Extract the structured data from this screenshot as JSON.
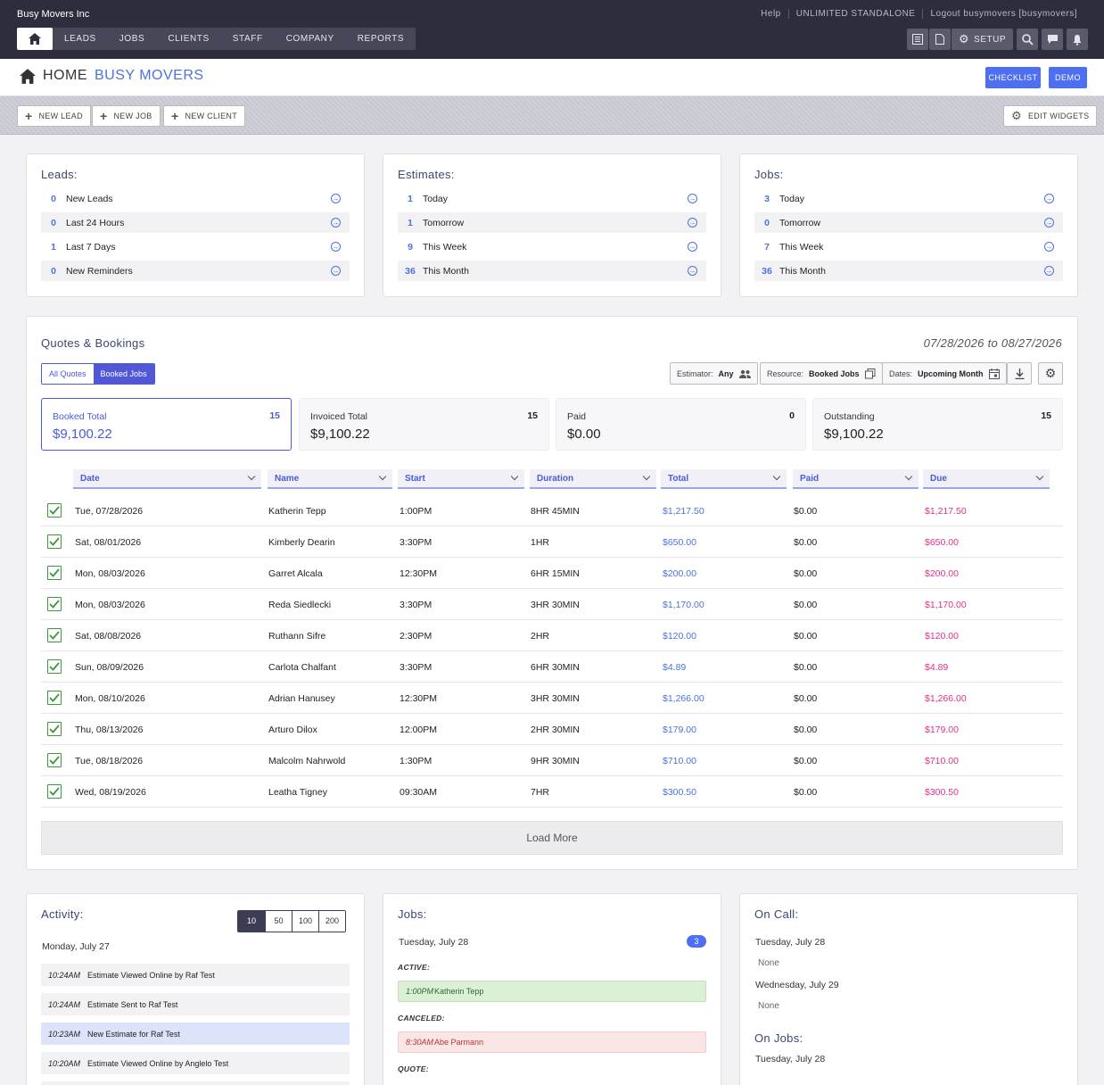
{
  "company": "Busy Movers Inc",
  "toplinks": [
    "Help",
    "UNLIMITED STANDALONE",
    "Logout busymovers [busymovers]"
  ],
  "nav": [
    "LEADS",
    "JOBS",
    "CLIENTS",
    "STAFF",
    "COMPANY",
    "REPORTS"
  ],
  "setup_label": "SETUP",
  "title": {
    "home": "HOME",
    "brand": "BUSY MOVERS"
  },
  "buttons": {
    "checklist": "CHECKLIST",
    "demo": "DEMO",
    "new_lead": "NEW LEAD",
    "new_job": "NEW JOB",
    "new_client": "NEW CLIENT",
    "edit_widgets": "EDIT WIDGETS"
  },
  "leads": {
    "title": "Leads:",
    "rows": [
      {
        "n": "0",
        "label": "New Leads"
      },
      {
        "n": "0",
        "label": "Last 24 Hours"
      },
      {
        "n": "1",
        "label": "Last 7 Days"
      },
      {
        "n": "0",
        "label": "New Reminders"
      }
    ]
  },
  "estimates": {
    "title": "Estimates:",
    "rows": [
      {
        "n": "1",
        "label": "Today"
      },
      {
        "n": "1",
        "label": "Tomorrow"
      },
      {
        "n": "9",
        "label": "This Week"
      },
      {
        "n": "36",
        "label": "This Month"
      }
    ]
  },
  "jobs_summary": {
    "title": "Jobs:",
    "rows": [
      {
        "n": "3",
        "label": "Today"
      },
      {
        "n": "0",
        "label": "Tomorrow"
      },
      {
        "n": "7",
        "label": "This Week"
      },
      {
        "n": "36",
        "label": "This Month"
      }
    ]
  },
  "qb": {
    "title": "Quotes & Bookings",
    "date_range": "07/28/2026 to 08/27/2026",
    "toggle": [
      "All Quotes",
      "Booked Jobs"
    ],
    "filters": {
      "estimator_label": "Estimator:",
      "estimator_value": "Any",
      "resource_label": "Resource:",
      "resource_value": "Booked Jobs",
      "dates_label": "Dates:",
      "dates_value": "Upcoming Month"
    },
    "totals": [
      {
        "label": "Booked Total",
        "count": "15",
        "value": "$9,100.22"
      },
      {
        "label": "Invoiced Total",
        "count": "15",
        "value": "$9,100.22"
      },
      {
        "label": "Paid",
        "count": "0",
        "value": "$0.00"
      },
      {
        "label": "Outstanding",
        "count": "15",
        "value": "$9,100.22"
      }
    ],
    "columns": [
      "Date",
      "Name",
      "Start",
      "Duration",
      "Total",
      "Paid",
      "Due"
    ],
    "rows": [
      [
        "Tue, 07/28/2026",
        "Katherin Tepp",
        "1:00PM",
        "8HR 45MIN",
        "$1,217.50",
        "$0.00",
        "$1,217.50"
      ],
      [
        "Sat, 08/01/2026",
        "Kimberly Dearin",
        "3:30PM",
        "1HR",
        "$650.00",
        "$0.00",
        "$650.00"
      ],
      [
        "Mon, 08/03/2026",
        "Garret Alcala",
        "12:30PM",
        "6HR 15MIN",
        "$200.00",
        "$0.00",
        "$200.00"
      ],
      [
        "Mon, 08/03/2026",
        "Reda Siedlecki",
        "3:30PM",
        "3HR 30MIN",
        "$1,170.00",
        "$0.00",
        "$1,170.00"
      ],
      [
        "Sat, 08/08/2026",
        "Ruthann Sifre",
        "2:30PM",
        "2HR",
        "$120.00",
        "$0.00",
        "$120.00"
      ],
      [
        "Sun, 08/09/2026",
        "Carlota Chalfant",
        "3:30PM",
        "6HR 30MIN",
        "$4.89",
        "$0.00",
        "$4.89"
      ],
      [
        "Mon, 08/10/2026",
        "Adrian Hanusey",
        "12:30PM",
        "3HR 30MIN",
        "$1,266.00",
        "$0.00",
        "$1,266.00"
      ],
      [
        "Thu, 08/13/2026",
        "Arturo Dilox",
        "12:00PM",
        "2HR 30MIN",
        "$179.00",
        "$0.00",
        "$179.00"
      ],
      [
        "Tue, 08/18/2026",
        "Malcolm Nahrwold",
        "1:30PM",
        "9HR 30MIN",
        "$710.00",
        "$0.00",
        "$710.00"
      ],
      [
        "Wed, 08/19/2026",
        "Leatha Tigney",
        "09:30AM",
        "7HR",
        "$300.50",
        "$0.00",
        "$300.50"
      ]
    ],
    "load_more": "Load More"
  },
  "activity": {
    "title": "Activity:",
    "pager": [
      "10",
      "50",
      "100",
      "200"
    ],
    "day": "Monday, July 27",
    "items": [
      {
        "time": "10:24AM",
        "text": "Estimate Viewed Online by Raf Test"
      },
      {
        "time": "10:24AM",
        "text": "Estimate Sent to Raf Test"
      },
      {
        "time": "10:23AM",
        "text": "New Estimate for Raf Test"
      },
      {
        "time": "10:20AM",
        "text": "Estimate Viewed Online by Anglelo Test"
      }
    ]
  },
  "jobs_day": {
    "title": "Jobs:",
    "day": "Tuesday, July 28",
    "badge": "3",
    "active_label": "ACTIVE:",
    "active": {
      "time": "1:00PM",
      "name": "Katherin Tepp"
    },
    "canceled_label": "CANCELED:",
    "canceled": {
      "time": "8:30AM",
      "name": "Abe Parmann"
    },
    "quote_label": "QUOTE:"
  },
  "oncall": {
    "title": "On Call:",
    "day1": "Tuesday, July 28",
    "none1": "None",
    "day2": "Wednesday, July 29",
    "none2": "None",
    "onjobs_title": "On Jobs:",
    "onjobs_day": "Tuesday, July 28"
  }
}
